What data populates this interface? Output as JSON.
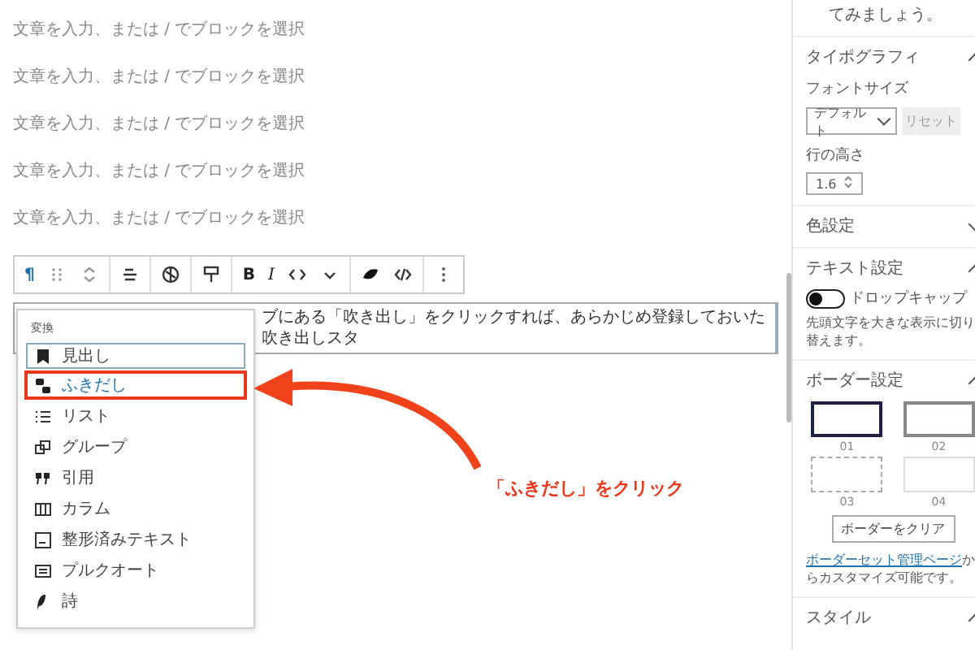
{
  "editor": {
    "placeholders": [
      "文章を入力、または / でブロックを選択",
      "文章を入力、または / でブロックを選択",
      "文章を入力、または / でブロックを選択",
      "文章を入力、または / でブロックを選択",
      "文章を入力、または / でブロックを選択"
    ],
    "toolbar": [
      {
        "items": [
          {
            "kind": "glyph",
            "label": "¶"
          },
          {
            "kind": "icon"
          },
          {
            "kind": "icon"
          }
        ]
      },
      {
        "items": [
          {
            "kind": "icon"
          }
        ]
      },
      {
        "items": [
          {
            "kind": "icon"
          }
        ]
      },
      {
        "items": [
          {
            "kind": "icon"
          }
        ]
      },
      {
        "items": [
          {
            "kind": "glyph",
            "label": "B"
          },
          {
            "kind": "glyph",
            "label": "I"
          },
          {
            "kind": "icon"
          },
          {
            "kind": "icon"
          }
        ]
      },
      {
        "items": [
          {
            "kind": "icon"
          },
          {
            "kind": "icon"
          }
        ]
      },
      {
        "items": [
          {
            "kind": "icon"
          }
        ]
      }
    ],
    "paragraph": "ブにある「吹き出し」をクリックすれば、あらかじめ登録しておいた吹き出しスタ",
    "transform_menu": {
      "heading": "変換",
      "items": [
        {
          "label": "見出し",
          "focused": true,
          "selected": false
        },
        {
          "label": "ふきだし",
          "focused": false,
          "selected": true
        },
        {
          "label": "リスト",
          "focused": false,
          "selected": false
        },
        {
          "label": "グループ",
          "focused": false,
          "selected": false
        },
        {
          "label": "引用",
          "focused": false,
          "selected": false
        },
        {
          "label": "カラム",
          "focused": false,
          "selected": false
        },
        {
          "label": "整形済みテキスト",
          "focused": false,
          "selected": false
        },
        {
          "label": "プルクオート",
          "focused": false,
          "selected": false
        },
        {
          "label": "詩",
          "focused": false,
          "selected": false
        }
      ]
    },
    "annotation": "「ふきだし」をクリック"
  },
  "sidebar": {
    "intro": "てみましょう。",
    "typography": {
      "title": "タイポグラフィ",
      "expanded": true,
      "font_size_label": "フォントサイズ",
      "font_size_value": "デフォルト",
      "reset_button": "リセット",
      "line_height_label": "行の高さ",
      "line_height_value": "1.6"
    },
    "color": {
      "title": "色設定",
      "expanded": false
    },
    "text_settings": {
      "title": "テキスト設定",
      "expanded": true,
      "drop_cap": {
        "label": "ドロップキャップ",
        "on": false
      },
      "help": "先頭文字を大きな表示に切り替えます。"
    },
    "border": {
      "title": "ボーダー設定",
      "expanded": true,
      "presets": [
        {
          "kind": "solid-dark",
          "label": "01",
          "selected": false
        },
        {
          "kind": "solid-grey",
          "label": "02",
          "selected": false
        },
        {
          "kind": "dashed",
          "label": "03",
          "selected": false
        },
        {
          "kind": "faint",
          "label": "04",
          "selected": false
        }
      ],
      "clear_button": "ボーダーをクリア",
      "link": "ボーダーセット管理ページ",
      "note": "からカスタマイズ可能です。"
    },
    "style": {
      "title": "スタイル",
      "expanded": true
    }
  }
}
